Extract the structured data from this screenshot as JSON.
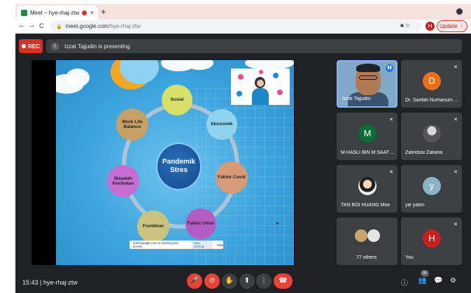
{
  "browser": {
    "tab_title": "Meet – hye-rhaj-ztw",
    "tab_close": "×",
    "new_tab": "+",
    "back": "←",
    "forward": "→",
    "reload": "C",
    "lock": "🔒",
    "url_host": "meet.google.com",
    "url_path": "/hye-rhaj-ztw",
    "omni_icons": "■  ☆",
    "profile_initial": "H",
    "update_label": "Update  ⋮"
  },
  "meet": {
    "rec_label": "REC",
    "presenter_initial": "I",
    "presenting_text": "Izzat Tajjudin is presenting",
    "slide": {
      "center_title": "Pandemik Stres",
      "nodes": [
        "Sosial",
        "Ekonomik",
        "Faktor Covid",
        "Faktor Umur",
        "Frontliner",
        "Masalah Kesihatan",
        "Work Life Balance"
      ],
      "share_text": "meet.google.com is sharing your screen.",
      "share_stop": "Stop sharing",
      "share_hide": "Hide"
    },
    "participants": [
      {
        "name": "Izzat Tajjudin",
        "initial": "",
        "color": "#7fa8c9"
      },
      {
        "name": "Dr. Sarifah Nurhanum ...",
        "initial": "D",
        "color": "#e8711c"
      },
      {
        "name": "M HASLI BIN M SAAT ...",
        "initial": "M",
        "color": "#0b6b3a"
      },
      {
        "name": "Zaliridzai Zakaria",
        "initial": "",
        "color": "#6b6b6b"
      },
      {
        "name": "TAN BOI HUANG Moe",
        "initial": "",
        "color": "#d6c4b8"
      },
      {
        "name": "yie yatim",
        "initial": "y",
        "color": "#8ab4c6"
      },
      {
        "name": "77 others",
        "initial": "",
        "color": "#5f6368"
      },
      {
        "name": "You",
        "initial": "H",
        "color": "#c5221f"
      }
    ],
    "bottom": {
      "time_code": "15:43  |  hye-rhaj-ztw",
      "mic_icon": "🎤",
      "cam_icon": "⊘",
      "hand_icon": "✋",
      "present_icon": "⬆",
      "more_icon": "⋮",
      "end_icon": "☎",
      "info_icon": "ⓘ",
      "people_icon": "👥",
      "people_count": "85",
      "chat_icon": "💬",
      "activities_icon": "⚙"
    }
  }
}
